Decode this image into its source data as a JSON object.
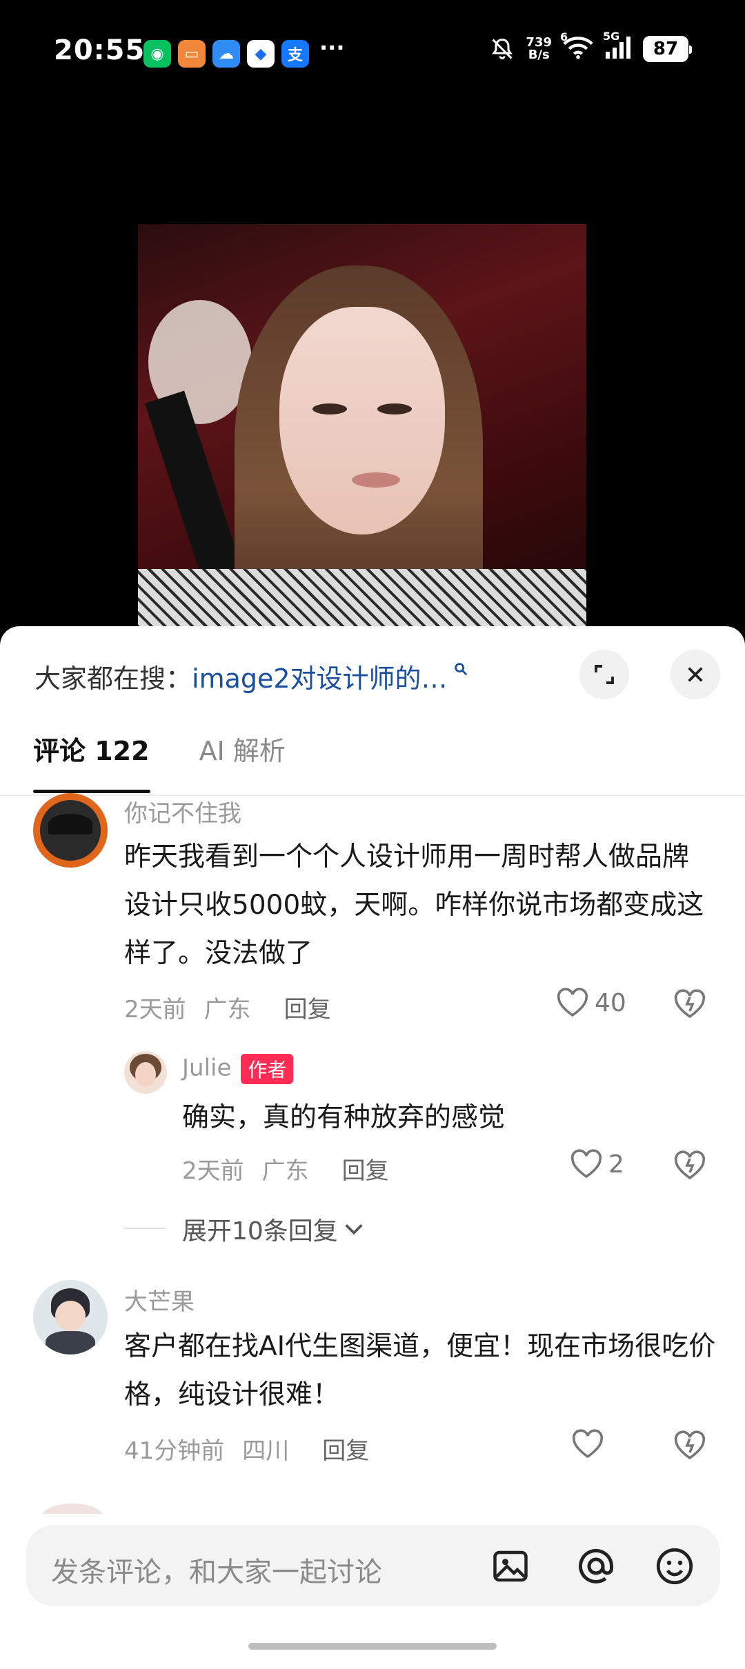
{
  "status_bar": {
    "time": "20:55",
    "apps": [
      {
        "name": "wechat-icon",
        "glyph": "◉",
        "color": "#07c160"
      },
      {
        "name": "wallet-icon",
        "glyph": "▭",
        "color": "#f0873a"
      },
      {
        "name": "weather-icon",
        "glyph": "☁",
        "color": "#2f8cf5"
      },
      {
        "name": "messenger-icon",
        "glyph": "◆",
        "color": "#1b6ef3"
      },
      {
        "name": "alipay-icon",
        "glyph": "支",
        "color": "#1677ff"
      }
    ],
    "more": "···",
    "net_speed_value": "739",
    "net_speed_unit": "B/s",
    "wifi_label": "6",
    "signal_label": "5G",
    "battery": "87"
  },
  "sheet": {
    "search_prefix": "大家都在搜：",
    "search_query": "image2对设计师的…",
    "tabs": [
      {
        "label": "评论 122",
        "active": true
      },
      {
        "label": "AI 解析",
        "active": false
      }
    ]
  },
  "comments": [
    {
      "username": "你记不住我",
      "text": "昨天我看到一个个人设计师用一周时帮人做品牌设计只收5000蚊，天啊。咋样你说市场都变成这样了。没法做了",
      "time": "2天前",
      "location": "广东",
      "reply_label": "回复",
      "likes": "40"
    },
    {
      "username": "Julie",
      "badge": "作者",
      "text": "确实，真的有种放弃的感觉",
      "time": "2天前",
      "location": "广东",
      "reply_label": "回复",
      "likes": "2"
    },
    {
      "username": "大芒果",
      "text": "客户都在找AI代生图渠道，便宜！现在市场很吃价格，纯设计很难！",
      "time": "41分钟前",
      "location": "四川",
      "reply_label": "回复",
      "likes": ""
    }
  ],
  "expand_replies": "展开10条回复",
  "input": {
    "placeholder": "发条评论，和大家一起讨论"
  }
}
